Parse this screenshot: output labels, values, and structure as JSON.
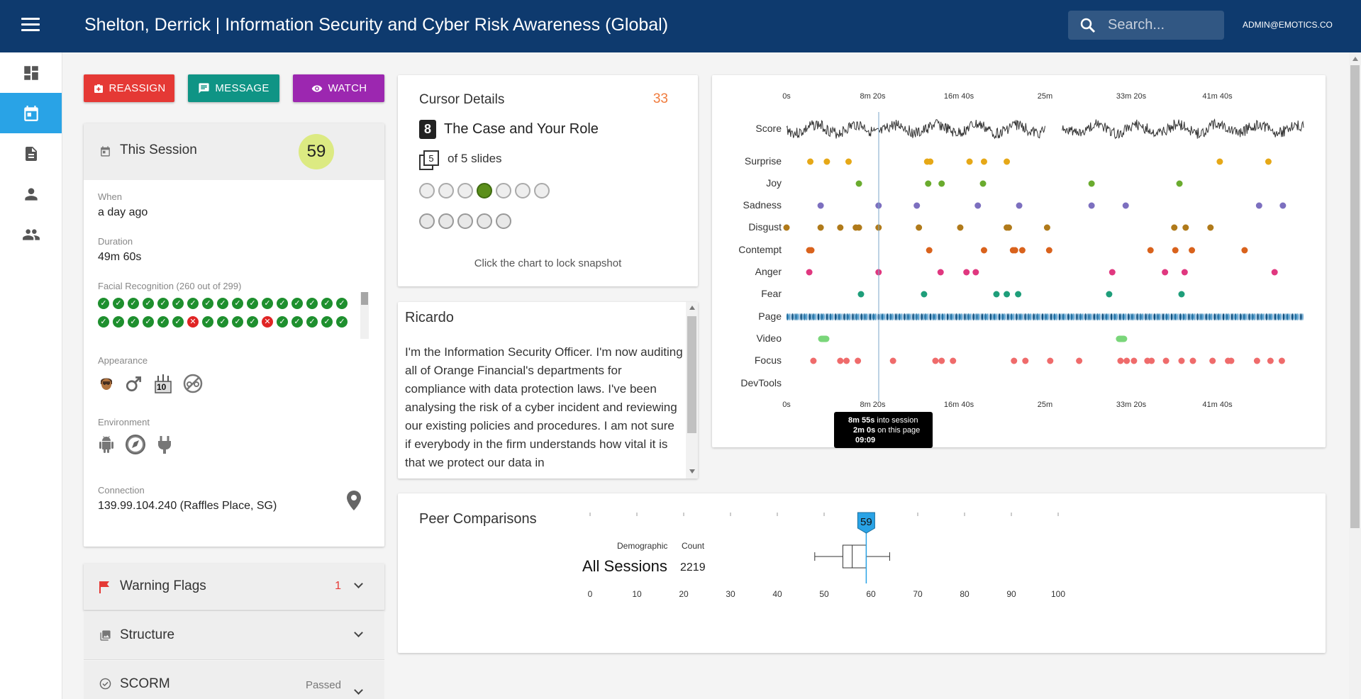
{
  "header": {
    "title": "Shelton, Derrick | Information Security and Cyber Risk Awareness (Global)",
    "search_placeholder": "Search...",
    "user": "ADMIN@EMOTICS.CO"
  },
  "nav": [
    {
      "icon": "dashboard-icon",
      "active": false
    },
    {
      "icon": "calendar-icon",
      "active": true
    },
    {
      "icon": "document-icon",
      "active": false
    },
    {
      "icon": "person-icon",
      "active": false
    },
    {
      "icon": "people-icon",
      "active": false
    }
  ],
  "actions": {
    "reassign": "REASSIGN",
    "message": "MESSAGE",
    "watch": "WATCH"
  },
  "session": {
    "title": "This Session",
    "score": "59",
    "when_label": "When",
    "when": "a day ago",
    "duration_label": "Duration",
    "duration": "49m 60s",
    "facial_label": "Facial Recognition (260 out of 299)",
    "appearance_label": "Appearance",
    "age_badge": "10",
    "environment_label": "Environment",
    "connection_label": "Connection",
    "connection": "139.99.104.240 (Raffles Place, SG)"
  },
  "accordion": {
    "warning": {
      "title": "Warning Flags",
      "count": "1"
    },
    "structure": {
      "title": "Structure"
    },
    "scorm": {
      "title": "SCORM",
      "status": "Passed"
    }
  },
  "cursor": {
    "title": "Cursor Details",
    "score": "33",
    "slide_num": "8",
    "slide_title": "The Case and Your Role",
    "slides_count": "5",
    "slides_text": "of 5 slides",
    "hint": "Click the chart to lock snapshot"
  },
  "transcript": {
    "speaker": "Ricardo",
    "text": "I'm the Information Security Officer. I'm now auditing all of Orange Financial's departments for compliance with data protection laws. I've been analysing the risk of a cyber incident and reviewing our existing policies and procedures. I am not sure if everybody in the firm understands how vital it is that we protect our data in"
  },
  "timeline": {
    "ticks": [
      "0s",
      "8m 20s",
      "16m 40s",
      "25m",
      "33m 20s",
      "41m 40s"
    ],
    "rows": [
      "Score",
      "Surprise",
      "Joy",
      "Sadness",
      "Disgust",
      "Contempt",
      "Anger",
      "Fear",
      "Page",
      "Video",
      "Focus",
      "DevTools"
    ],
    "colors": {
      "Surprise": "#e6a817",
      "Joy": "#6aab2e",
      "Sadness": "#7c6fbf",
      "Disgust": "#b07a1a",
      "Contempt": "#d9621c",
      "Anger": "#e0377f",
      "Fear": "#1e9e7a",
      "Video": "#7ad67a",
      "Focus": "#ef6b6b"
    },
    "tooltip": {
      "line1_bold": "8m 55s",
      "line1": " into session",
      "line2_bold": "2m 0s",
      "line2": " on this page",
      "line3": "09:09"
    }
  },
  "chart_data": {
    "type": "scatter",
    "title": "",
    "xlabel": "",
    "ylabel": "",
    "xlim_seconds": [
      0,
      3000
    ],
    "x_ticks": [
      "0s",
      "8m 20s",
      "16m 40s",
      "25m",
      "33m 20s",
      "41m 40s"
    ],
    "cursor_seconds": 535,
    "series": [
      {
        "name": "Surprise",
        "x_minutes": [
          2.3,
          3.9,
          6,
          13.6,
          13.9,
          17.7,
          19.1,
          21.3,
          41.9,
          46.6
        ]
      },
      {
        "name": "Joy",
        "x_minutes": [
          7,
          13.7,
          15,
          19,
          29.5,
          38
        ]
      },
      {
        "name": "Sadness",
        "x_minutes": [
          3.3,
          8.9,
          12.6,
          18.5,
          22.5,
          29.5,
          32.8,
          45.7,
          48
        ]
      },
      {
        "name": "Disgust",
        "x_minutes": [
          0,
          3.3,
          5.2,
          6.7,
          7,
          8.9,
          12.8,
          16.8,
          21.3,
          21.5,
          25.2,
          37.5,
          38.6,
          41
        ]
      },
      {
        "name": "Contempt",
        "x_minutes": [
          2.2,
          2.4,
          13.8,
          19.1,
          21.9,
          22.1,
          22.8,
          25.4,
          35.2,
          37.6,
          39.2,
          44.3
        ]
      },
      {
        "name": "Anger",
        "x_minutes": [
          2.2,
          8.9,
          14.9,
          17.4,
          18.3,
          31.5,
          36.6,
          38.5,
          47.2
        ]
      },
      {
        "name": "Fear",
        "x_minutes": [
          7.2,
          13.3,
          20.3,
          21.3,
          22.4,
          31.2,
          38.2
        ]
      },
      {
        "name": "Video",
        "x_minutes": [
          3.6,
          32.4
        ]
      },
      {
        "name": "Focus",
        "x_minutes": [
          2.6,
          5.2,
          5.8,
          6.9,
          10.3,
          14.4,
          15,
          16.1,
          22,
          23.1,
          25.5,
          28.3,
          32.3,
          32.9,
          33.6,
          34.9,
          35.3,
          36.7,
          38.2,
          39.3,
          41.2,
          42.7,
          43,
          45.5,
          46.8,
          47.9
        ]
      }
    ]
  },
  "peer": {
    "title": "Peer Comparisons",
    "demographic_label": "Demographic",
    "count_label": "Count",
    "row_label": "All Sessions",
    "row_count": "2219",
    "score_marker": "59",
    "axis_ticks": [
      "0",
      "10",
      "20",
      "30",
      "40",
      "50",
      "60",
      "70",
      "80",
      "90",
      "100"
    ],
    "box": {
      "min": 48,
      "q1": 54,
      "median": 56,
      "q3": 59,
      "max": 64
    },
    "marker_value": 59
  }
}
